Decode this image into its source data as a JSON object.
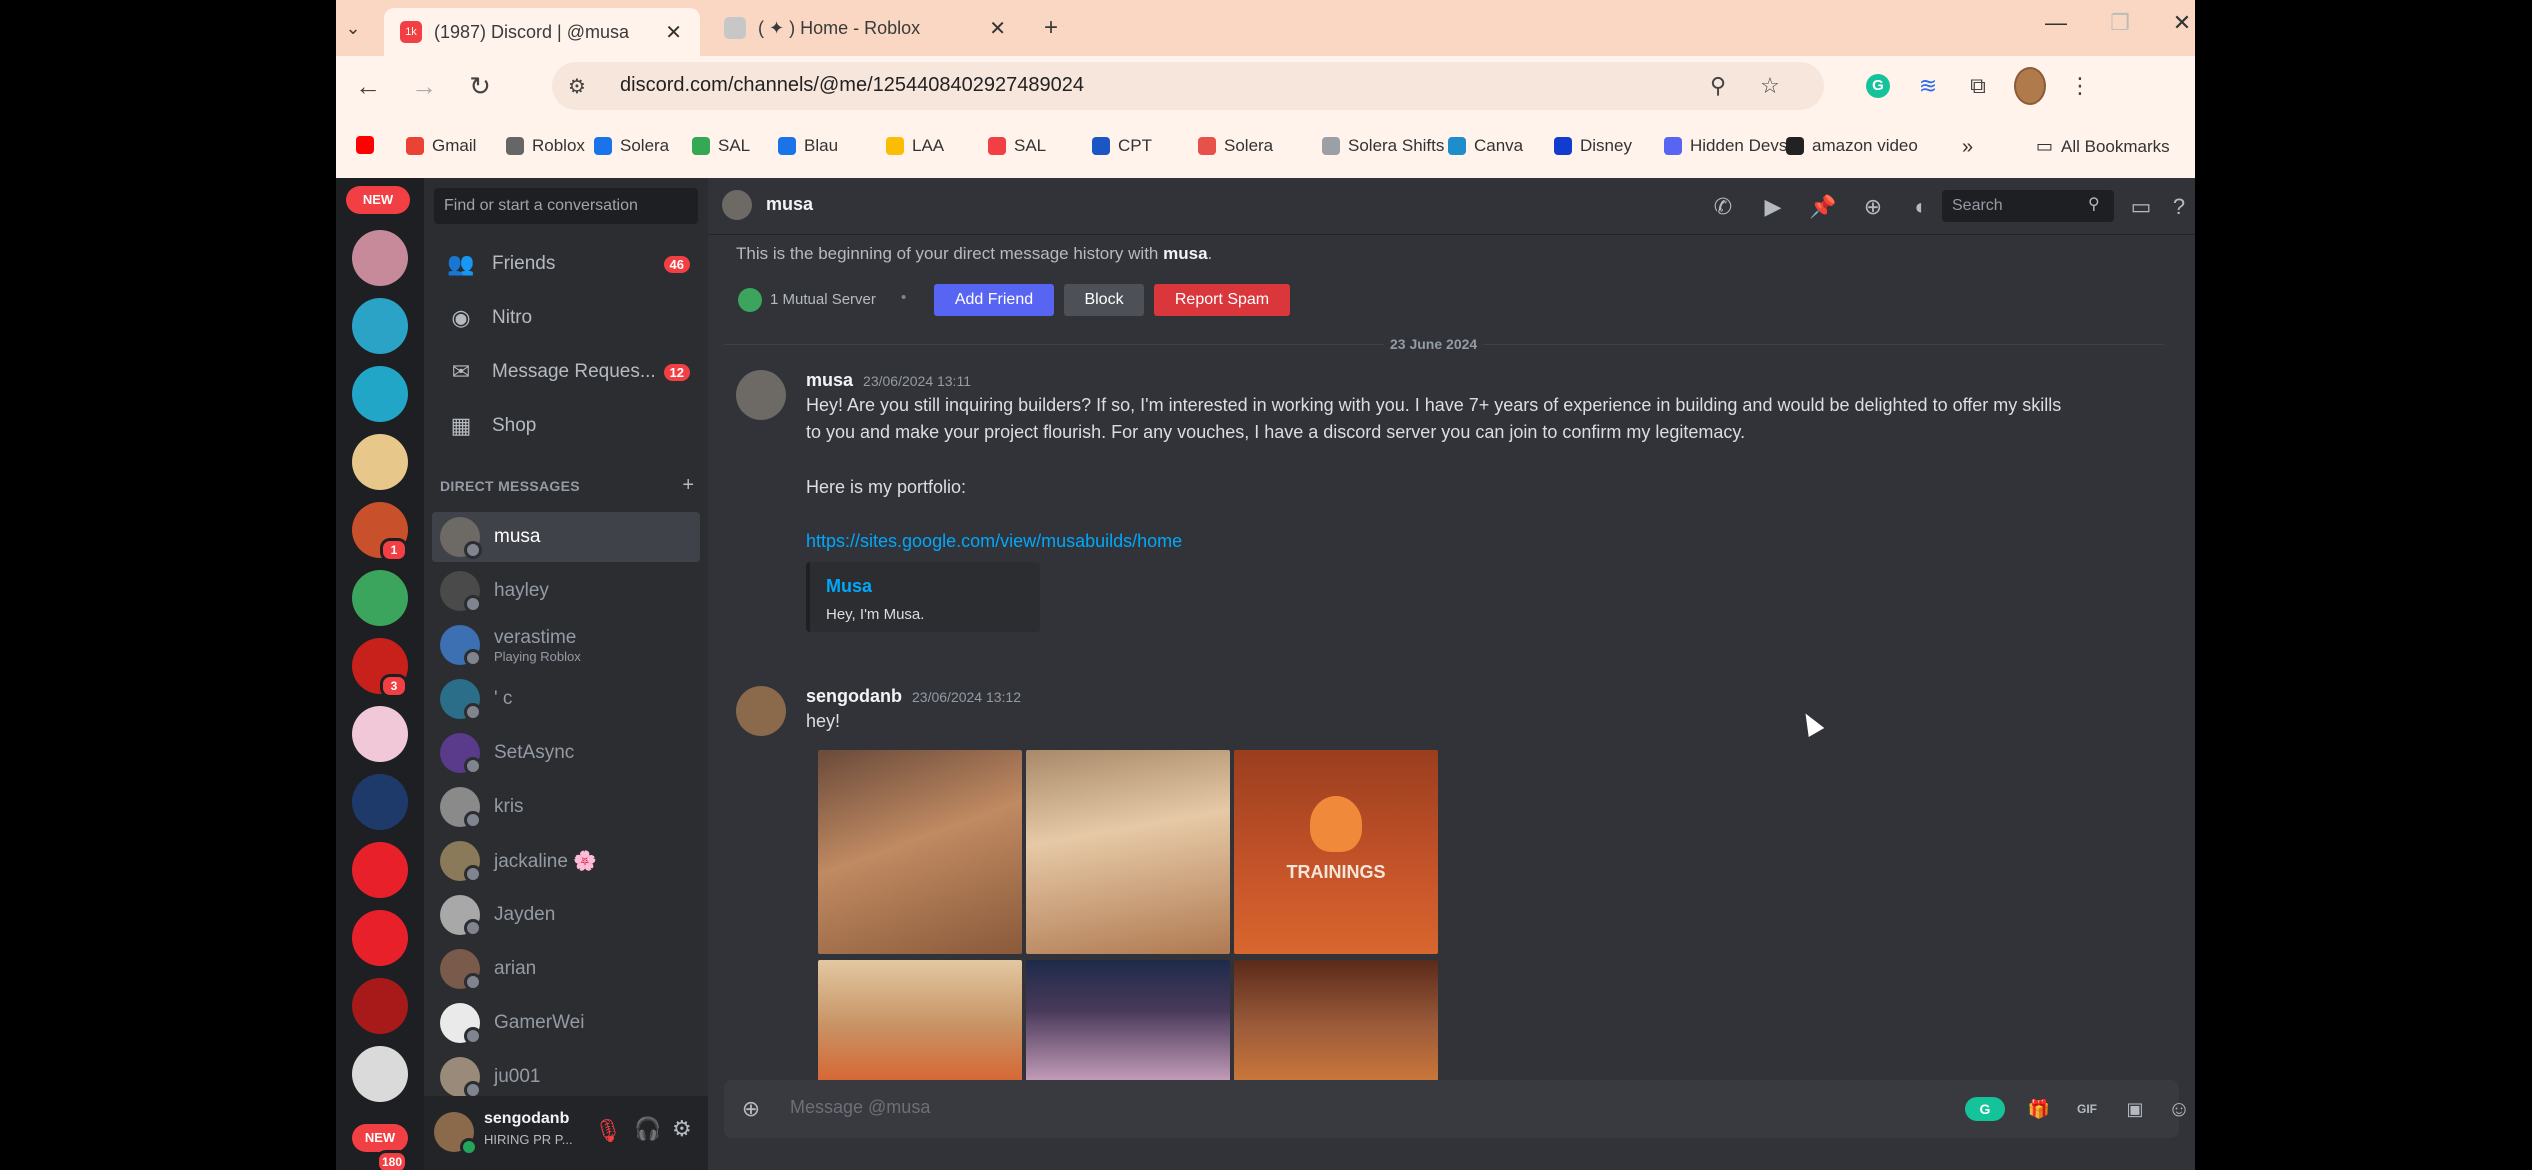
{
  "browser": {
    "tabs": [
      {
        "title": "(1987) Discord | @musa",
        "favicon_color": "#f23f43",
        "favicon_text": "1k"
      },
      {
        "title": "( ✦ ) Home - Roblox",
        "favicon_color": "#c7c7c7",
        "favicon_text": ""
      }
    ],
    "url": "discord.com/channels/@me/1254408402927489024",
    "bookmarks": [
      {
        "label": "Gmail",
        "color": "#ea4335"
      },
      {
        "label": "Roblox",
        "color": "#666666"
      },
      {
        "label": "Solera",
        "color": "#1a73e8"
      },
      {
        "label": "SAL",
        "color": "#34a853"
      },
      {
        "label": "Blau",
        "color": "#1a73e8"
      },
      {
        "label": "LAA",
        "color": "#fbbc04"
      },
      {
        "label": "SAL",
        "color": "#f23f43"
      },
      {
        "label": "CPT",
        "color": "#1a56c4"
      },
      {
        "label": "Solera",
        "color": "#e8504a"
      },
      {
        "label": "Solera Shifts",
        "color": "#9aa0a6"
      },
      {
        "label": "Canva",
        "color": "#1d8ecb"
      },
      {
        "label": "Disney",
        "color": "#113ccf"
      },
      {
        "label": "Hidden Devs",
        "color": "#5865f2"
      },
      {
        "label": "amazon video",
        "color": "#222222"
      }
    ],
    "all_bookmarks": "All Bookmarks",
    "more_bookmarks": "»"
  },
  "sidebar": {
    "new_label": "NEW",
    "find_placeholder": "Find or start a conversation",
    "nav": [
      {
        "label": "Friends",
        "icon": "friends-icon",
        "glyph": "👥",
        "count": "46"
      },
      {
        "label": "Nitro",
        "icon": "nitro-icon",
        "glyph": "◉",
        "count": ""
      },
      {
        "label": "Message Reques...",
        "icon": "envelope-icon",
        "glyph": "✉",
        "count": "12"
      },
      {
        "label": "Shop",
        "icon": "shop-icon",
        "glyph": "▦",
        "count": ""
      }
    ],
    "dm_header": "DIRECT MESSAGES",
    "dms": [
      {
        "name": "musa",
        "sub": "",
        "color": "#6d6a66",
        "selected": true
      },
      {
        "name": "hayley",
        "sub": "",
        "color": "#4a4a4a"
      },
      {
        "name": "verastime",
        "sub": "Playing Roblox",
        "color": "#3d6fb3"
      },
      {
        "name": "' c",
        "sub": "",
        "color": "#2a6e8a"
      },
      {
        "name": "SetAsync",
        "sub": "",
        "color": "#5a3a8a"
      },
      {
        "name": "kris",
        "sub": "",
        "color": "#8a8a8a"
      },
      {
        "name": "jackaline 🌸",
        "sub": "",
        "color": "#8a7a5a"
      },
      {
        "name": "Jayden",
        "sub": "",
        "color": "#a8a8a8"
      },
      {
        "name": "arian",
        "sub": "",
        "color": "#7a5a4a"
      },
      {
        "name": "GamerWei",
        "sub": "",
        "color": "#eaeaea"
      },
      {
        "name": "ju001",
        "sub": "",
        "color": "#9a8a7a"
      }
    ],
    "user": {
      "name": "sengodanb",
      "status": "HIRING PR P..."
    }
  },
  "servers": [
    {
      "color": "#c78a9a",
      "badge": ""
    },
    {
      "color": "#2aa3c7",
      "badge": ""
    },
    {
      "color": "#22a6c8",
      "badge": ""
    },
    {
      "color": "#e8c88a",
      "badge": ""
    },
    {
      "color": "#c8502a",
      "badge": "1"
    },
    {
      "color": "#3ba55d",
      "badge": ""
    },
    {
      "color": "#c8201a",
      "badge": "3"
    },
    {
      "color": "#f0c8d8",
      "badge": ""
    },
    {
      "color": "#1e3a6a",
      "badge": ""
    },
    {
      "color": "#e8202a",
      "badge": ""
    },
    {
      "color": "#e8202a",
      "badge": ""
    },
    {
      "color": "#a81a1a",
      "badge": ""
    },
    {
      "color": "#dadada",
      "badge": ""
    }
  ],
  "server_bottom": {
    "new_label": "NEW",
    "count": "180"
  },
  "chat": {
    "recipient": "musa",
    "search_placeholder": "Search",
    "intro_prefix": "This is the beginning of your direct message history with",
    "intro_name": "musa",
    "intro_suffix": ".",
    "mutual": "1 Mutual Server",
    "mutual_sep": "•",
    "add_friend": "Add Friend",
    "block": "Block",
    "report": "Report Spam",
    "date_divider": "23 June 2024",
    "messages": [
      {
        "author": "musa",
        "timestamp": "23/06/2024 13:11",
        "lines": [
          "Hey! Are you still inquiring builders? If so, I'm interested in working with you. I have 7+ years of experience in building and would be delighted to offer my skills",
          "to you and make your project flourish. For any vouches, I have a discord server you can join to confirm my legitemacy."
        ],
        "portfolio_label": "Here is my portfolio:",
        "link": "https://sites.google.com/view/musabuilds/home",
        "embed_title": "Musa",
        "embed_desc": "Hey, I'm Musa."
      },
      {
        "author": "sengodanb",
        "timestamp": "23/06/2024 13:12",
        "text": "hey!",
        "tile_text": "TRAININGS"
      }
    ],
    "composer_placeholder": "Message @musa"
  }
}
